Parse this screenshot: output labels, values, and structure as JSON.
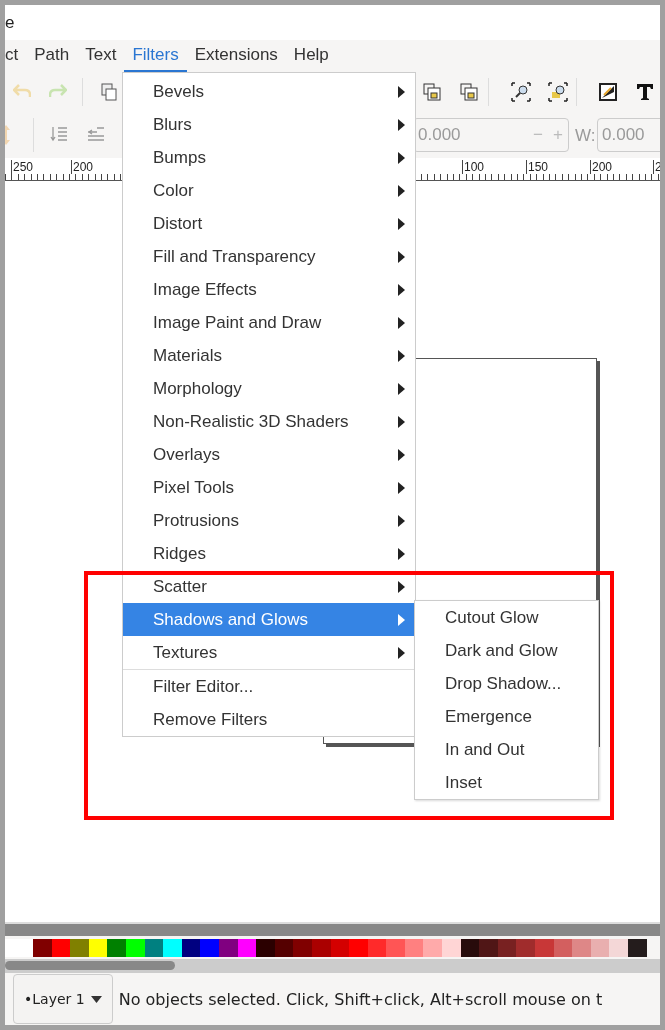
{
  "title_fragment": "e",
  "menubar": [
    {
      "label": "ct",
      "selected": false
    },
    {
      "label": "Path",
      "selected": false
    },
    {
      "label": "Text",
      "selected": false
    },
    {
      "label": "Filters",
      "selected": true
    },
    {
      "label": "Extensions",
      "selected": false
    },
    {
      "label": "Help",
      "selected": false
    }
  ],
  "toolbar": {
    "field_value": "0.000",
    "minus": "−",
    "plus": "+",
    "w_label": "W:",
    "w_value": "0.000"
  },
  "ruler": {
    "labels": [
      "250",
      "200",
      "100",
      "150",
      "200",
      "2"
    ]
  },
  "filters_menu": {
    "submenus": [
      {
        "label": "Bevels",
        "selected": false
      },
      {
        "label": "Blurs",
        "selected": false
      },
      {
        "label": "Bumps",
        "selected": false
      },
      {
        "label": "Color",
        "selected": false
      },
      {
        "label": "Distort",
        "selected": false
      },
      {
        "label": "Fill and Transparency",
        "selected": false
      },
      {
        "label": "Image Effects",
        "selected": false
      },
      {
        "label": "Image Paint and Draw",
        "selected": false
      },
      {
        "label": "Materials",
        "selected": false
      },
      {
        "label": "Morphology",
        "selected": false
      },
      {
        "label": "Non-Realistic 3D Shaders",
        "selected": false
      },
      {
        "label": "Overlays",
        "selected": false
      },
      {
        "label": "Pixel Tools",
        "selected": false
      },
      {
        "label": "Protrusions",
        "selected": false
      },
      {
        "label": "Ridges",
        "selected": false
      },
      {
        "label": "Scatter",
        "selected": false
      },
      {
        "label": "Shadows and Glows",
        "selected": true
      },
      {
        "label": "Textures",
        "selected": false
      }
    ],
    "actions": [
      "Filter Editor...",
      "Remove Filters"
    ]
  },
  "submenu": {
    "items": [
      "Cutout Glow",
      "Dark and Glow",
      "Drop Shadow...",
      "Emergence",
      "In and Out",
      "Inset"
    ]
  },
  "palette": [
    {
      "color": "#ffffff"
    },
    {
      "color": "#800000"
    },
    {
      "color": "#ff0000"
    },
    {
      "color": "#808000"
    },
    {
      "color": "#ffff00"
    },
    {
      "color": "#008000"
    },
    {
      "color": "#00ff00"
    },
    {
      "color": "#008080"
    },
    {
      "color": "#00ffff"
    },
    {
      "color": "#000080"
    },
    {
      "color": "#0000ff"
    },
    {
      "color": "#800080"
    },
    {
      "color": "#ff00ff"
    },
    {
      "color": "#2b0000"
    },
    {
      "color": "#550000"
    },
    {
      "color": "#800000"
    },
    {
      "color": "#aa0000"
    },
    {
      "color": "#d40000"
    },
    {
      "color": "#ff0000"
    },
    {
      "color": "#ff2a2a"
    },
    {
      "color": "#ff5555"
    },
    {
      "color": "#ff8080"
    },
    {
      "color": "#ffaaaa"
    },
    {
      "color": "#ffd5d5"
    },
    {
      "color": "#280b0b"
    },
    {
      "color": "#501616"
    },
    {
      "color": "#782121"
    },
    {
      "color": "#a02c2c"
    },
    {
      "color": "#c83737"
    },
    {
      "color": "#d35f5f"
    },
    {
      "color": "#de8787"
    },
    {
      "color": "#e9afaf"
    },
    {
      "color": "#f4d7d7"
    },
    {
      "color": "#241c1c"
    }
  ],
  "status": {
    "layer": "•Layer 1",
    "message": "No objects selected. Click, Shift+click, Alt+scroll mouse on t"
  }
}
